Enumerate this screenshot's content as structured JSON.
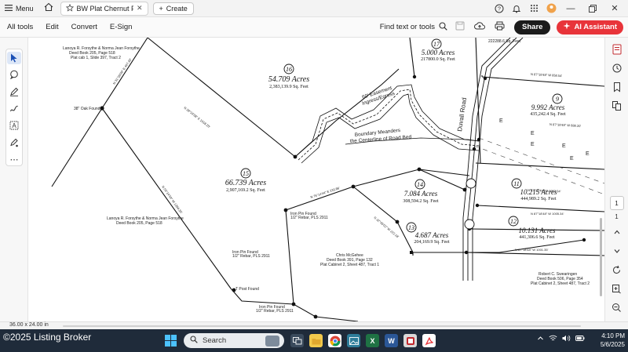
{
  "titlebar": {
    "menu_label": "Menu",
    "tab_title": "BW Plat Chernut Farms ...",
    "create_label": "Create"
  },
  "toolbar": {
    "menu_items": [
      "All tools",
      "Edit",
      "Convert",
      "E-Sign"
    ],
    "find_label": "Find text or tools",
    "share_label": "Share",
    "ai_label": "AI Assistant"
  },
  "document": {
    "tracts": [
      {
        "num": "16",
        "acres": "54.709 Acres",
        "sqft": "2,383,139.9 Sq. Feet"
      },
      {
        "num": "17",
        "acres": "5.000 Acres",
        "sqft": "217800.0 Sq. Feet"
      },
      {
        "num": "15",
        "acres": "66.739 Acres",
        "sqft": "2,907,169.2 Sq. Feet"
      },
      {
        "num": "14",
        "acres": "7.084 Acres",
        "sqft": "308,594.2 Sq. Feet"
      },
      {
        "num": "13",
        "acres": "4.687 Acres",
        "sqft": "204,169.9 Sq. Feet"
      },
      {
        "num": "9",
        "acres": "9.992 Acres",
        "sqft": "435,242.4 Sq. Feet"
      },
      {
        "num": "11",
        "acres": "10.215 Acres",
        "sqft": "444,989.2 Sq. Feet"
      },
      {
        "num": "12",
        "acres": "10.131 Acres",
        "sqft": "441,306.6 Sq. Feet"
      }
    ],
    "notes": {
      "owner_top": [
        "Lanoya R. Forsythe & Norma Jean Forsythe",
        "Deed Book 205, Page 518",
        "Plat cab 1, Slide 397, Tract 2"
      ],
      "oak_found": "38\" Oak Found",
      "easement": [
        "60' Easement",
        "Ingress/Egress"
      ],
      "boundary": [
        "Boundary Meanders",
        "the Centerline of Road Bed"
      ],
      "road_name": "Duvall Road",
      "owner_left": [
        "Lanoya R. Forsythe & Norma Jean Forsythe",
        "Deed Book 205, Page 518"
      ],
      "pin_found": [
        "Iron Pin Found",
        "1/2\" Rebar, PLS 2911"
      ],
      "owner_mid": [
        "Chris McGehee",
        "Deed Book 391, Page 132",
        "Plat Cabinet 2, Sheet 487, Tract 1"
      ],
      "post_found": "T Post Found",
      "owner_br": [
        "Robert C. Swearingen",
        "Deed Book 506, Page 354",
        "Plat Cabinet 2, Sheet 487, Tract 2"
      ],
      "sqft_top": "222288.6 Sq. Feet"
    },
    "page_size": "36.00 x 24.00 in",
    "page_number": "1",
    "page_total": "1"
  },
  "taskbar": {
    "watermark": "©2025 Listing Broker",
    "search_placeholder": "Search",
    "time": "4:10 PM",
    "date": "5/6/2025"
  },
  "colors": {
    "accent_red": "#e8343a",
    "share_dark": "#1b1b1b",
    "taskbar": "#1f2b3a"
  }
}
